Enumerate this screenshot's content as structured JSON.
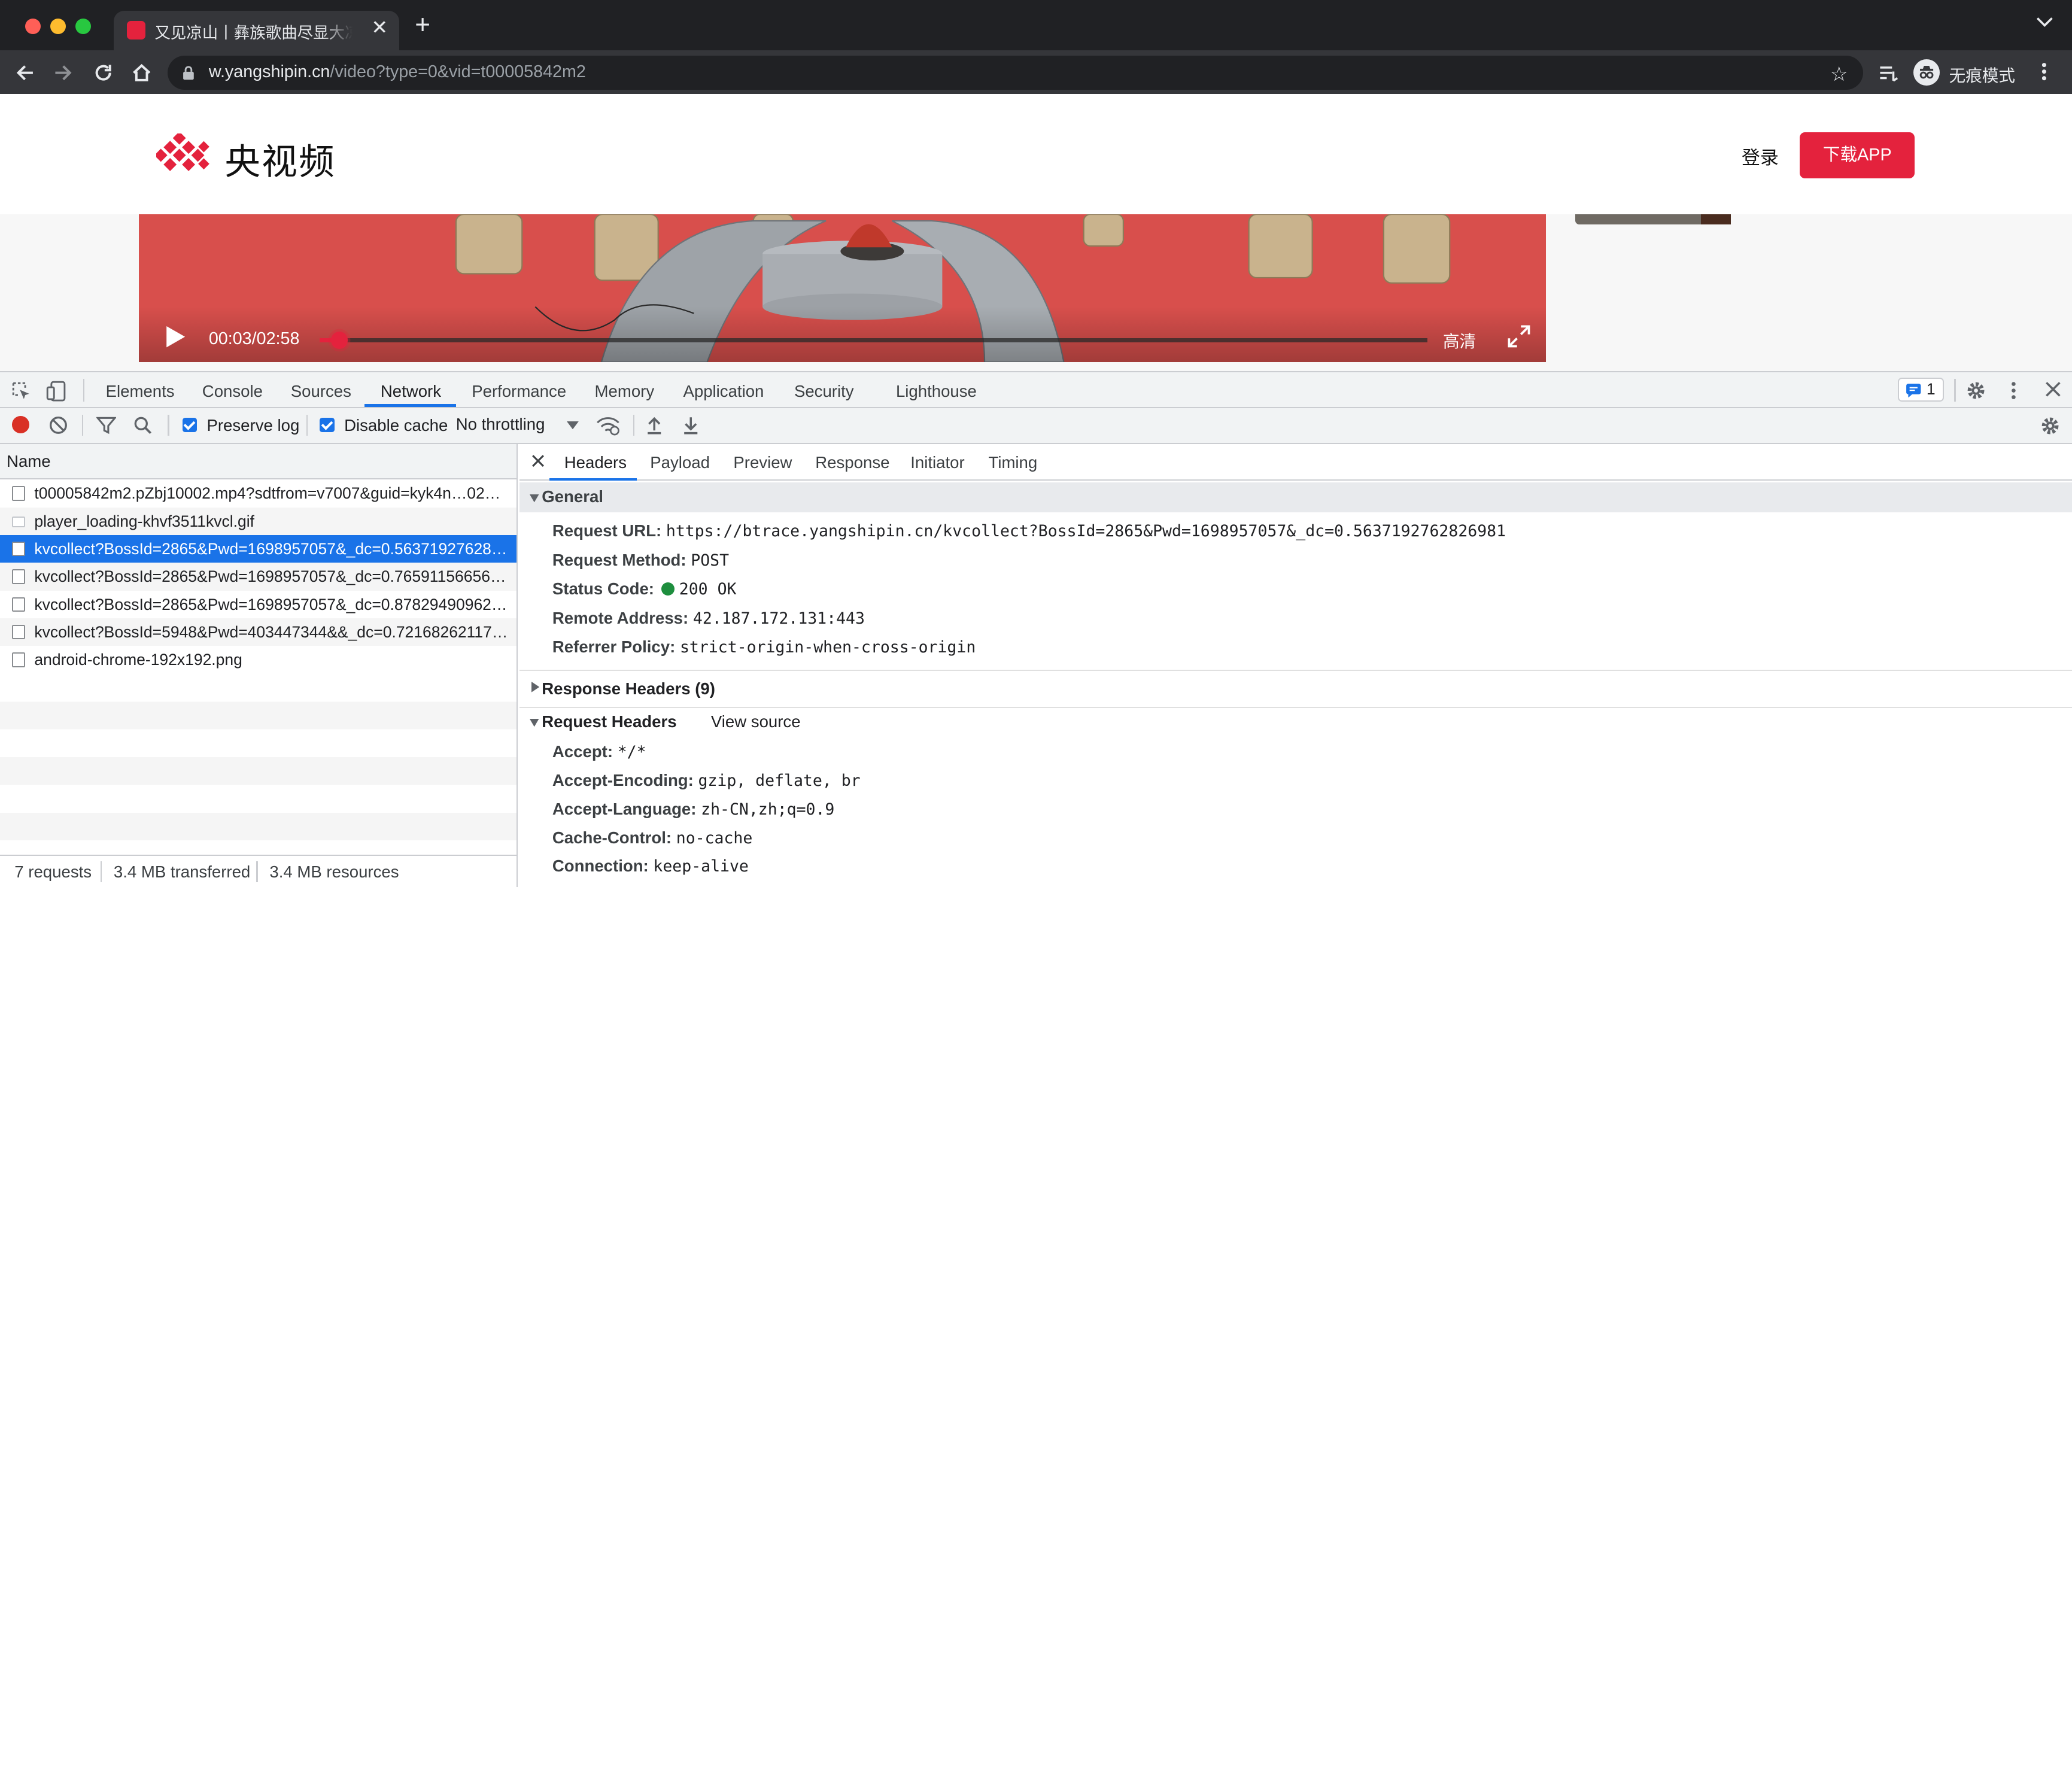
{
  "browser": {
    "tab_title": "又见凉山丨彝族歌曲尽显大凉山之美",
    "new_tab_glyph": "+",
    "url_host": "w.yangshipin.cn",
    "url_path": "/video?type=0&vid=t00005842m2",
    "incognito_label": "无痕模式"
  },
  "site": {
    "logo_text": "央视频",
    "login_label": "登录",
    "download_label": "下载APP",
    "brand_color": "#e4223d"
  },
  "player": {
    "time_current": "00:03",
    "time_total": "02:58",
    "time_separator": "/",
    "quality_label": "高清",
    "progress": 0.017
  },
  "devtools": {
    "tabs": [
      "Elements",
      "Console",
      "Sources",
      "Network",
      "Performance",
      "Memory",
      "Application",
      "Security",
      "Lighthouse"
    ],
    "active_tab": "Network",
    "issues_count": "1",
    "preserve_log_label": "Preserve log",
    "disable_cache_label": "Disable cache",
    "throttling_value": "No throttling",
    "name_column": "Name",
    "requests": [
      "t00005842m2.pZbj10002.mp4?sdtfrom=v7007&guid=kyk4n…02…",
      "player_loading-khvf3511kvcl.gif",
      "kvcollect?BossId=2865&Pwd=1698957057&_dc=0.56371927628…",
      "kvcollect?BossId=2865&Pwd=1698957057&_dc=0.76591156656…",
      "kvcollect?BossId=2865&Pwd=1698957057&_dc=0.87829490962…",
      "kvcollect?BossId=5948&Pwd=403447344&&_dc=0.72168262117…",
      "android-chrome-192x192.png"
    ],
    "selected_index": 2,
    "summary": {
      "requests": "7 requests",
      "transferred": "3.4 MB transferred",
      "resources": "3.4 MB resources"
    },
    "detail_tabs": [
      "Headers",
      "Payload",
      "Preview",
      "Response",
      "Initiator",
      "Timing"
    ],
    "active_detail_tab": "Headers",
    "general": {
      "title": "General",
      "request_url_label": "Request URL:",
      "request_url": "https://btrace.yangshipin.cn/kvcollect?BossId=2865&Pwd=1698957057&_dc=0.5637192762826981",
      "method_label": "Request Method:",
      "method": "POST",
      "status_label": "Status Code:",
      "status": "200 OK",
      "remote_label": "Remote Address:",
      "remote": "42.187.172.131:443",
      "referrer_label": "Referrer Policy:",
      "referrer": "strict-origin-when-cross-origin"
    },
    "response_headers_title": "Response Headers (9)",
    "request_headers_title": "Request Headers",
    "view_source_label": "View source",
    "request_headers": [
      {
        "name": "Accept:",
        "value": "*/*"
      },
      {
        "name": "Accept-Encoding:",
        "value": "gzip, deflate, br"
      },
      {
        "name": "Accept-Language:",
        "value": "zh-CN,zh;q=0.9"
      },
      {
        "name": "Cache-Control:",
        "value": "no-cache"
      },
      {
        "name": "Connection:",
        "value": "keep-alive"
      }
    ]
  }
}
